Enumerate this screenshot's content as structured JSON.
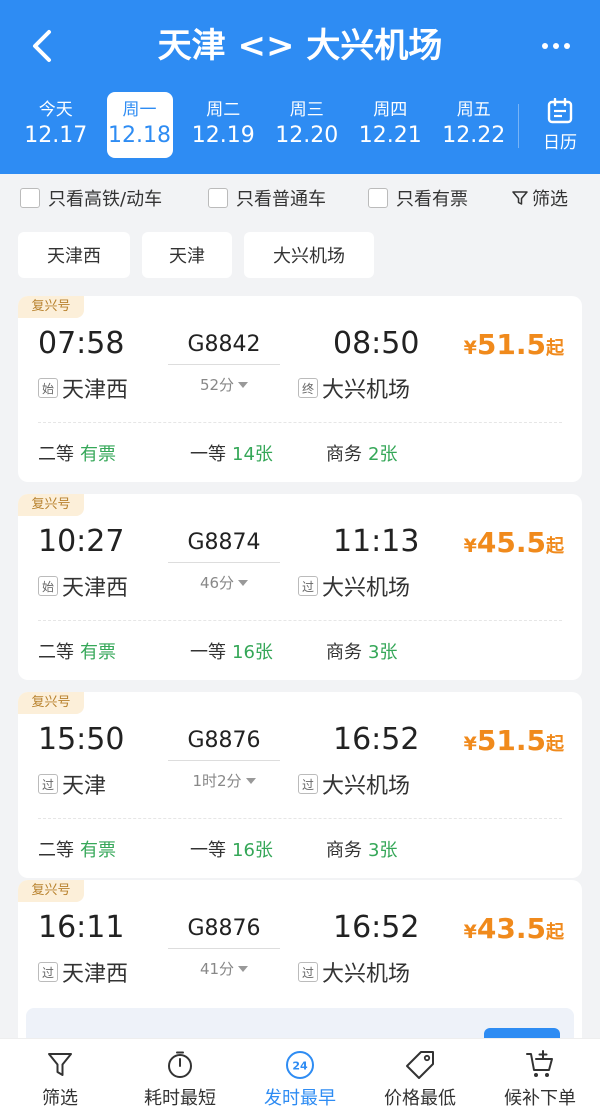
{
  "header": {
    "title": "天津 <> 大兴机场",
    "dates": [
      {
        "weekday": "今天",
        "date": "12.17"
      },
      {
        "weekday": "周一",
        "date": "12.18"
      },
      {
        "weekday": "周二",
        "date": "12.19"
      },
      {
        "weekday": "周三",
        "date": "12.20"
      },
      {
        "weekday": "周四",
        "date": "12.21"
      },
      {
        "weekday": "周五",
        "date": "12.22"
      }
    ],
    "active_date_index": 1,
    "calendar_label": "日历"
  },
  "filters": {
    "high_speed": "只看高铁/动车",
    "ordinary": "只看普通车",
    "available": "只看有票",
    "filter_label": "筛选"
  },
  "station_chips": [
    "天津西",
    "天津",
    "大兴机场"
  ],
  "trains": [
    {
      "badge": "复兴号",
      "dep_time": "07:58",
      "train_no": "G8842",
      "arr_time": "08:50",
      "duration": "52分",
      "dep_tag": "始",
      "dep_station": "天津西",
      "arr_tag": "终",
      "arr_station": "大兴机场",
      "price": "51.5",
      "currency": "¥",
      "price_suffix": "起",
      "seats": [
        {
          "class": "二等",
          "value": "有票"
        },
        {
          "class": "一等",
          "value": "14张"
        },
        {
          "class": "商务",
          "value": "2张"
        }
      ]
    },
    {
      "badge": "复兴号",
      "dep_time": "10:27",
      "train_no": "G8874",
      "arr_time": "11:13",
      "duration": "46分",
      "dep_tag": "始",
      "dep_station": "天津西",
      "arr_tag": "过",
      "arr_station": "大兴机场",
      "price": "45.5",
      "currency": "¥",
      "price_suffix": "起",
      "seats": [
        {
          "class": "二等",
          "value": "有票"
        },
        {
          "class": "一等",
          "value": "16张"
        },
        {
          "class": "商务",
          "value": "3张"
        }
      ]
    },
    {
      "badge": "复兴号",
      "dep_time": "15:50",
      "train_no": "G8876",
      "arr_time": "16:52",
      "duration": "1时2分",
      "dep_tag": "过",
      "dep_station": "天津",
      "arr_tag": "过",
      "arr_station": "大兴机场",
      "price": "51.5",
      "currency": "¥",
      "price_suffix": "起",
      "seats": [
        {
          "class": "二等",
          "value": "有票"
        },
        {
          "class": "一等",
          "value": "16张"
        },
        {
          "class": "商务",
          "value": "3张"
        }
      ]
    },
    {
      "badge": "复兴号",
      "dep_time": "16:11",
      "train_no": "G8876",
      "arr_time": "16:52",
      "duration": "41分",
      "dep_tag": "过",
      "dep_station": "天津西",
      "arr_tag": "过",
      "arr_station": "大兴机场",
      "price": "43.5",
      "currency": "¥",
      "price_suffix": "起",
      "seats": []
    }
  ],
  "bottom_bar": {
    "items": [
      {
        "label": "筛选",
        "icon": "funnel-icon"
      },
      {
        "label": "耗时最短",
        "icon": "stopwatch-icon"
      },
      {
        "label": "发时最早",
        "icon": "clock-24-icon",
        "badge": "24"
      },
      {
        "label": "价格最低",
        "icon": "price-tag-icon"
      },
      {
        "label": "候补下单",
        "icon": "cart-plus-icon"
      }
    ],
    "active_index": 2
  },
  "colors": {
    "brand_blue": "#2e8cf3",
    "price_orange": "#f08a1c",
    "available_green": "#35a758",
    "badge_bg": "#fcefd9"
  }
}
